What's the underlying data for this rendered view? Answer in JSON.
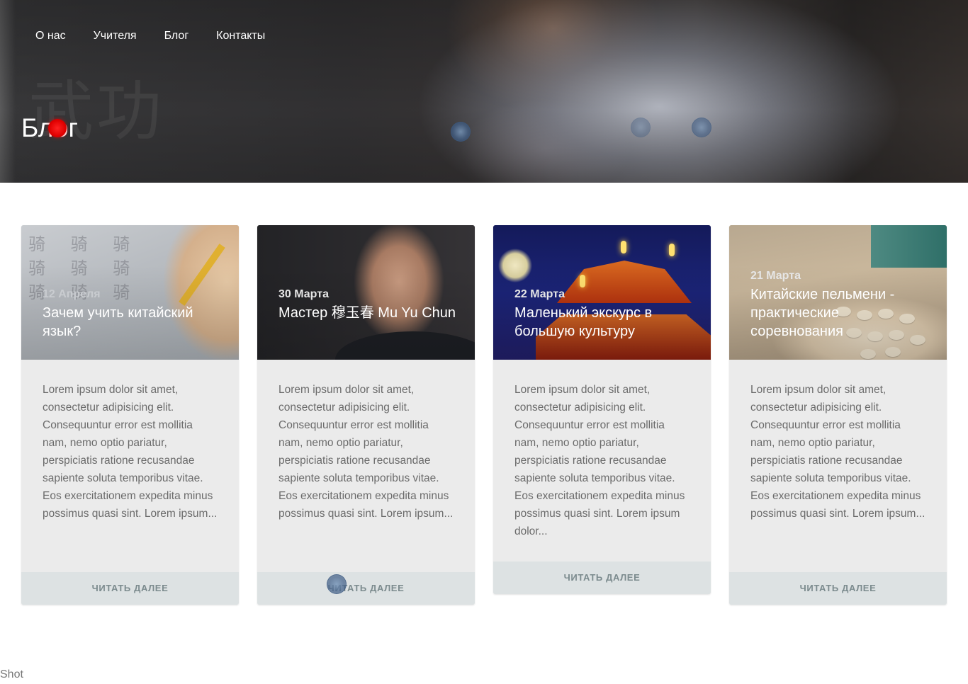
{
  "nav": {
    "items": [
      {
        "label": "О нас"
      },
      {
        "label": "Учителя"
      },
      {
        "label": "Блог"
      },
      {
        "label": "Контакты"
      }
    ]
  },
  "hero": {
    "title": "Блог"
  },
  "posts": [
    {
      "date": "12 Апреля",
      "title": "Зачем учить китайский язык?",
      "excerpt": "Lorem ipsum dolor sit amet, consectetur adipisicing elit. Consequuntur error est mollitia nam, nemo optio pariatur, perspiciatis ratione recusandae sapiente soluta temporibus vitae. Eos exercitationem expedita minus possimus quasi sint. Lorem ipsum...",
      "button_label": "ЧИТАТЬ ДАЛЕЕ"
    },
    {
      "date": "30 Марта",
      "title": "Мастер 穆玉春 Mu Yu Chun",
      "excerpt": "Lorem ipsum dolor sit amet, consectetur adipisicing elit. Consequuntur error est mollitia nam, nemo optio pariatur, perspiciatis ratione recusandae sapiente soluta temporibus vitae. Eos exercitationem expedita minus possimus quasi sint. Lorem ipsum...",
      "button_label": "ЧИТАТЬ ДАЛЕЕ"
    },
    {
      "date": "22 Марта",
      "title": "Маленький экскурс в большую культуру",
      "excerpt": "Lorem ipsum dolor sit amet, consectetur adipisicing elit. Consequuntur error est mollitia nam, nemo optio pariatur, perspiciatis ratione recusandae sapiente soluta temporibus vitae. Eos exercitationem expedita minus possimus quasi sint. Lorem ipsum dolor...",
      "button_label": "ЧИТАТЬ ДАЛЕЕ"
    },
    {
      "date": "21 Марта",
      "title": "Китайские пельмени - практические соревнования",
      "excerpt": "Lorem ipsum dolor sit amet, consectetur adipisicing elit. Consequuntur error est mollitia nam, nemo optio pariatur, perspiciatis ratione recusandae sapiente soluta temporibus vitae. Eos exercitationem expedita minus possimus quasi sint. Lorem ipsum...",
      "button_label": "ЧИТАТЬ ДАЛЕЕ"
    }
  ],
  "footer": {
    "text": "Shot"
  },
  "colors": {
    "card_bg": "#ebebeb",
    "button_bg": "#dde2e3",
    "button_text": "#7c8b8e",
    "excerpt_text": "#6b6b6b"
  }
}
